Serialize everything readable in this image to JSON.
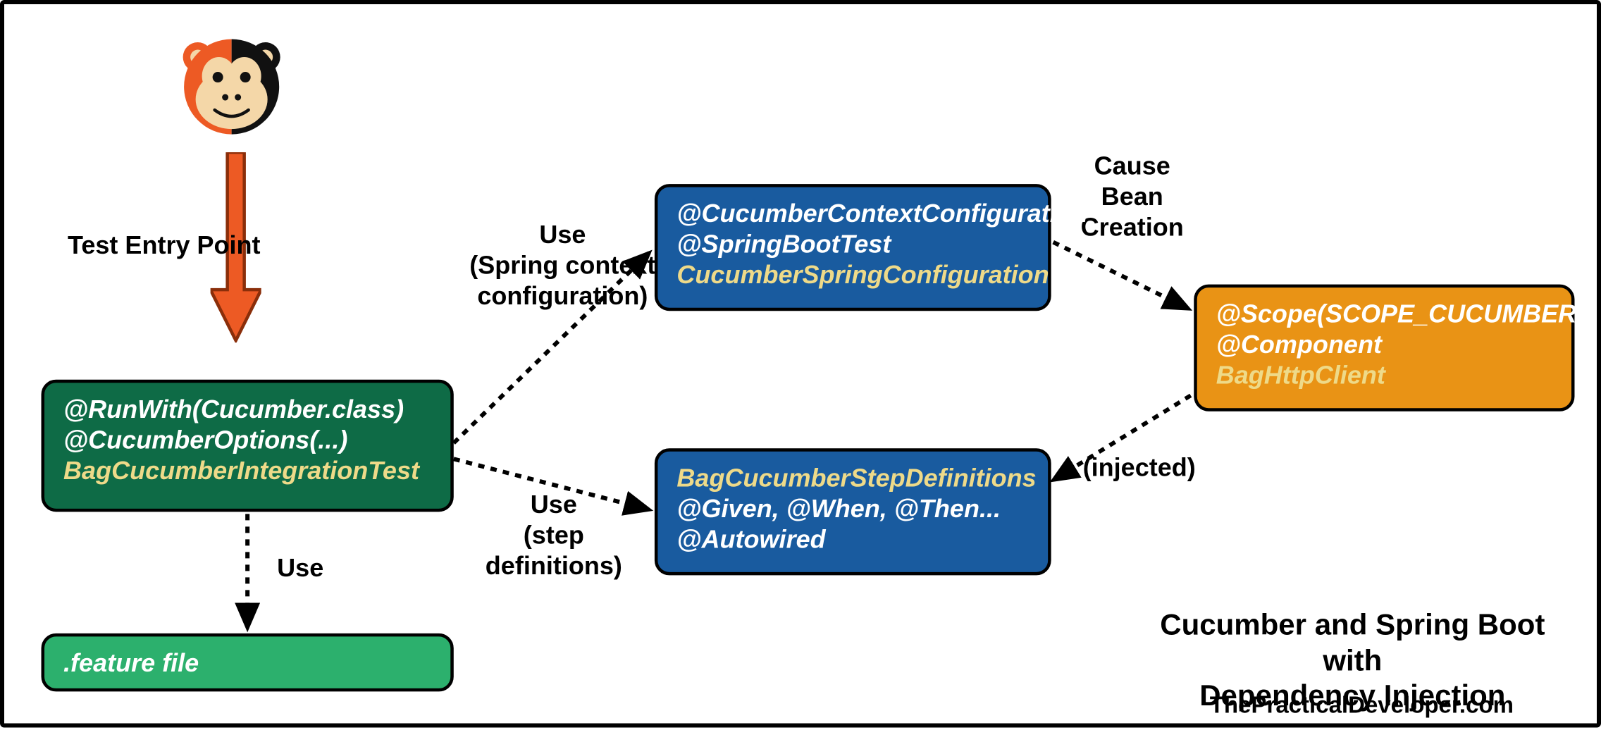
{
  "labels": {
    "entry": "Test Entry Point",
    "useSpring1": "Use",
    "useSpring2": "(Spring context",
    "useSpring3": "configuration)",
    "useSteps1": "Use",
    "useSteps2": "(step",
    "useSteps3": "definitions)",
    "useFeature": "Use",
    "cause1": "Cause",
    "cause2": "Bean",
    "cause3": "Creation",
    "injected": "(injected)"
  },
  "boxes": {
    "integration": {
      "ann1": "@RunWith(Cucumber.class)",
      "ann2": "@CucumberOptions(...)",
      "cls": "BagCucumberIntegrationTest"
    },
    "feature": {
      "ann1": ".feature file"
    },
    "spring": {
      "ann1": "@CucumberContextConfiguration",
      "ann2": "@SpringBootTest",
      "cls": "CucumberSpringConfiguration"
    },
    "steps": {
      "cls": "BagCucumberStepDefinitions",
      "ann1": "@Given, @When, @Then...",
      "ann2": "@Autowired"
    },
    "http": {
      "ann1": "@Scope(SCOPE_CUCUMBER_GLUE)",
      "ann2": "@Component",
      "cls": "BagHttpClient"
    }
  },
  "footer": {
    "title1": "Cucumber and Spring Boot with",
    "title2": "Dependency Injection",
    "credit": "ThePracticalDeveloper.com"
  }
}
